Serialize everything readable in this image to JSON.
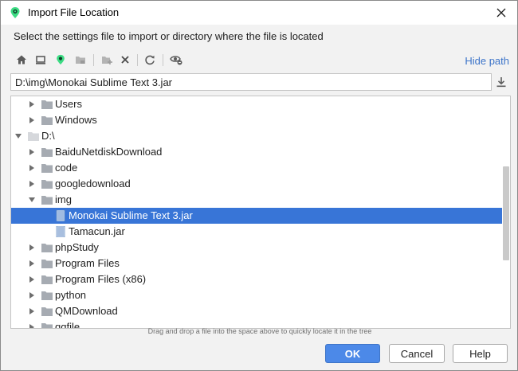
{
  "window": {
    "title": "Import File Location",
    "instruction": "Select the settings file to import or directory where the file is located"
  },
  "toolbar": {
    "buttons": [
      "home-icon",
      "desktop-icon",
      "project-icon",
      "module-folder-icon",
      "new-folder-icon",
      "delete-icon",
      "refresh-icon",
      "show-hidden-icon"
    ],
    "hide_path_label": "Hide path"
  },
  "path": {
    "value": "D:\\img\\Monokai Sublime Text 3.jar"
  },
  "tree": {
    "items": [
      {
        "label": "Users",
        "level": 2,
        "type": "folder",
        "expanded": false
      },
      {
        "label": "Windows",
        "level": 2,
        "type": "folder",
        "expanded": false
      },
      {
        "label": "D:\\",
        "level": 1,
        "type": "drive",
        "expanded": true
      },
      {
        "label": "BaiduNetdiskDownload",
        "level": 2,
        "type": "folder",
        "expanded": false
      },
      {
        "label": "code",
        "level": 2,
        "type": "folder",
        "expanded": false
      },
      {
        "label": "googledownload",
        "level": 2,
        "type": "folder",
        "expanded": false
      },
      {
        "label": "img",
        "level": 2,
        "type": "folder",
        "expanded": true
      },
      {
        "label": "Monokai Sublime Text 3.jar",
        "level": 3,
        "type": "jar",
        "selected": true
      },
      {
        "label": "Tamacun.jar",
        "level": 3,
        "type": "jar"
      },
      {
        "label": "phpStudy",
        "level": 2,
        "type": "folder",
        "expanded": false
      },
      {
        "label": "Program Files",
        "level": 2,
        "type": "folder",
        "expanded": false
      },
      {
        "label": "Program Files (x86)",
        "level": 2,
        "type": "folder",
        "expanded": false
      },
      {
        "label": "python",
        "level": 2,
        "type": "folder",
        "expanded": false
      },
      {
        "label": "QMDownload",
        "level": 2,
        "type": "folder",
        "expanded": false
      },
      {
        "label": "qqfile",
        "level": 2,
        "type": "folder",
        "expanded": false
      }
    ]
  },
  "hint": "Drag and drop a file into the space above to quickly locate it in the tree",
  "buttons": {
    "ok": "OK",
    "cancel": "Cancel",
    "help": "Help"
  },
  "colors": {
    "accent": "#4c89e8",
    "selection": "#3875d7",
    "link": "#3c74c9",
    "app_icon": "#3ddc84"
  }
}
